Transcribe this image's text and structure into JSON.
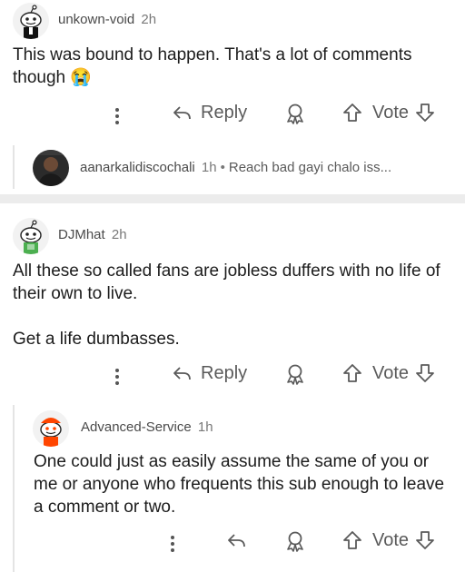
{
  "colors": {
    "accent_red": "#ff4500",
    "separator": "#ececec",
    "thread_line": "#e4e4e4"
  },
  "comments": [
    {
      "username": "unkown-void",
      "time": "2h",
      "body": [
        "This was bound to happen. That's a lot of comments though 😭"
      ],
      "reply_label": "Reply",
      "vote_label": "Vote",
      "avatar_icon": "snoo-avatar-icon",
      "reply": {
        "username": "aanarkalidiscochali",
        "time": "1h",
        "preview": "Reach bad gayi chalo iss..."
      }
    },
    {
      "username": "DJMhat",
      "time": "2h",
      "body": [
        "All these so called fans are jobless duffers with no life of their own to live.",
        "Get a life dumbasses."
      ],
      "reply_label": "Reply",
      "vote_label": "Vote",
      "avatar_icon": "snoo-avatar-icon",
      "reply": {
        "username": "Advanced-Service",
        "time": "1h",
        "body": "One could just as easily assume the same of you or me or anyone who frequents this sub enough to leave a comment or two.",
        "vote_label": "Vote"
      }
    }
  ]
}
